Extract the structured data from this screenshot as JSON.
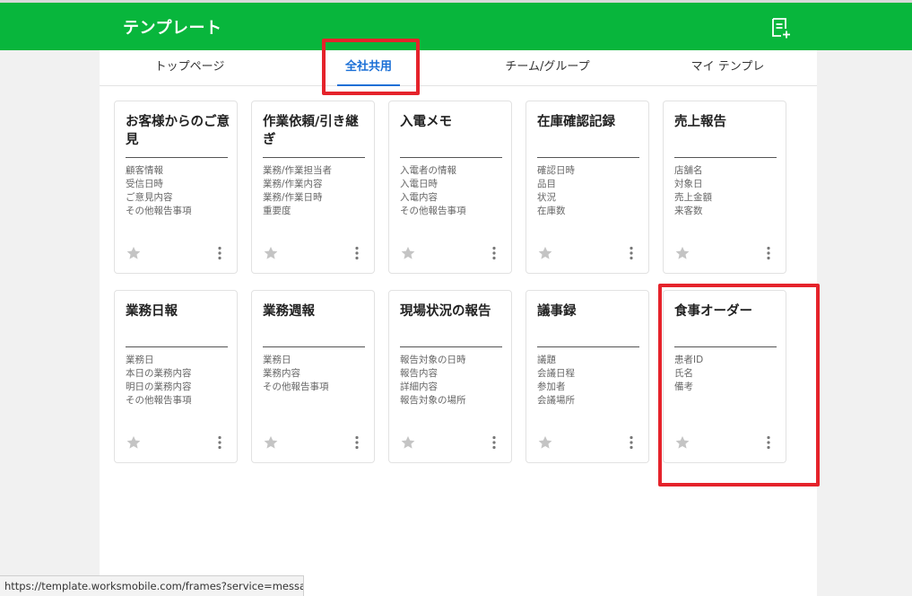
{
  "header": {
    "title": "テンプレート",
    "new_template_icon": "note-add-icon"
  },
  "tabs": [
    {
      "label": "トップページ"
    },
    {
      "label": "全社共用"
    },
    {
      "label": "チーム/グループ"
    },
    {
      "label": "マイ テンプレ"
    }
  ],
  "active_tab": "全社共用",
  "cards": [
    {
      "title": "お客様からのご意見",
      "fields": [
        "顧客情報",
        "受信日時",
        "ご意見内容",
        "その他報告事項"
      ]
    },
    {
      "title": "作業依頼/引き継ぎ",
      "fields": [
        "業務/作業担当者",
        "業務/作業内容",
        "業務/作業日時",
        "重要度"
      ]
    },
    {
      "title": "入電メモ",
      "fields": [
        "入電者の情報",
        "入電日時",
        "入電内容",
        "その他報告事項"
      ]
    },
    {
      "title": "在庫確認記録",
      "fields": [
        "確認日時",
        "品目",
        "状況",
        "在庫数"
      ]
    },
    {
      "title": "売上報告",
      "fields": [
        "店舗名",
        "対象日",
        "売上金額",
        "来客数"
      ]
    },
    {
      "title": "業務日報",
      "fields": [
        "業務日",
        "本日の業務内容",
        "明日の業務内容",
        "その他報告事項"
      ]
    },
    {
      "title": "業務週報",
      "fields": [
        "業務日",
        "業務内容",
        "その他報告事項"
      ]
    },
    {
      "title": "現場状況の報告",
      "fields": [
        "報告対象の日時",
        "報告内容",
        "詳細内容",
        "報告対象の場所"
      ]
    },
    {
      "title": "議事録",
      "fields": [
        "議題",
        "会議日程",
        "参加者",
        "会議場所"
      ]
    },
    {
      "title": "食事オーダー",
      "fields": [
        "患者ID",
        "氏名",
        "備考"
      ]
    }
  ],
  "card_icons": {
    "favorite": "star-icon",
    "menu": "more-vertical-icon"
  },
  "status_bar": {
    "url": "https://template.worksmobile.com/frames?service=message..."
  },
  "colors": {
    "header_green": "#08b63c",
    "active_blue": "#1a6fd6",
    "highlight_red": "#e5232b"
  }
}
